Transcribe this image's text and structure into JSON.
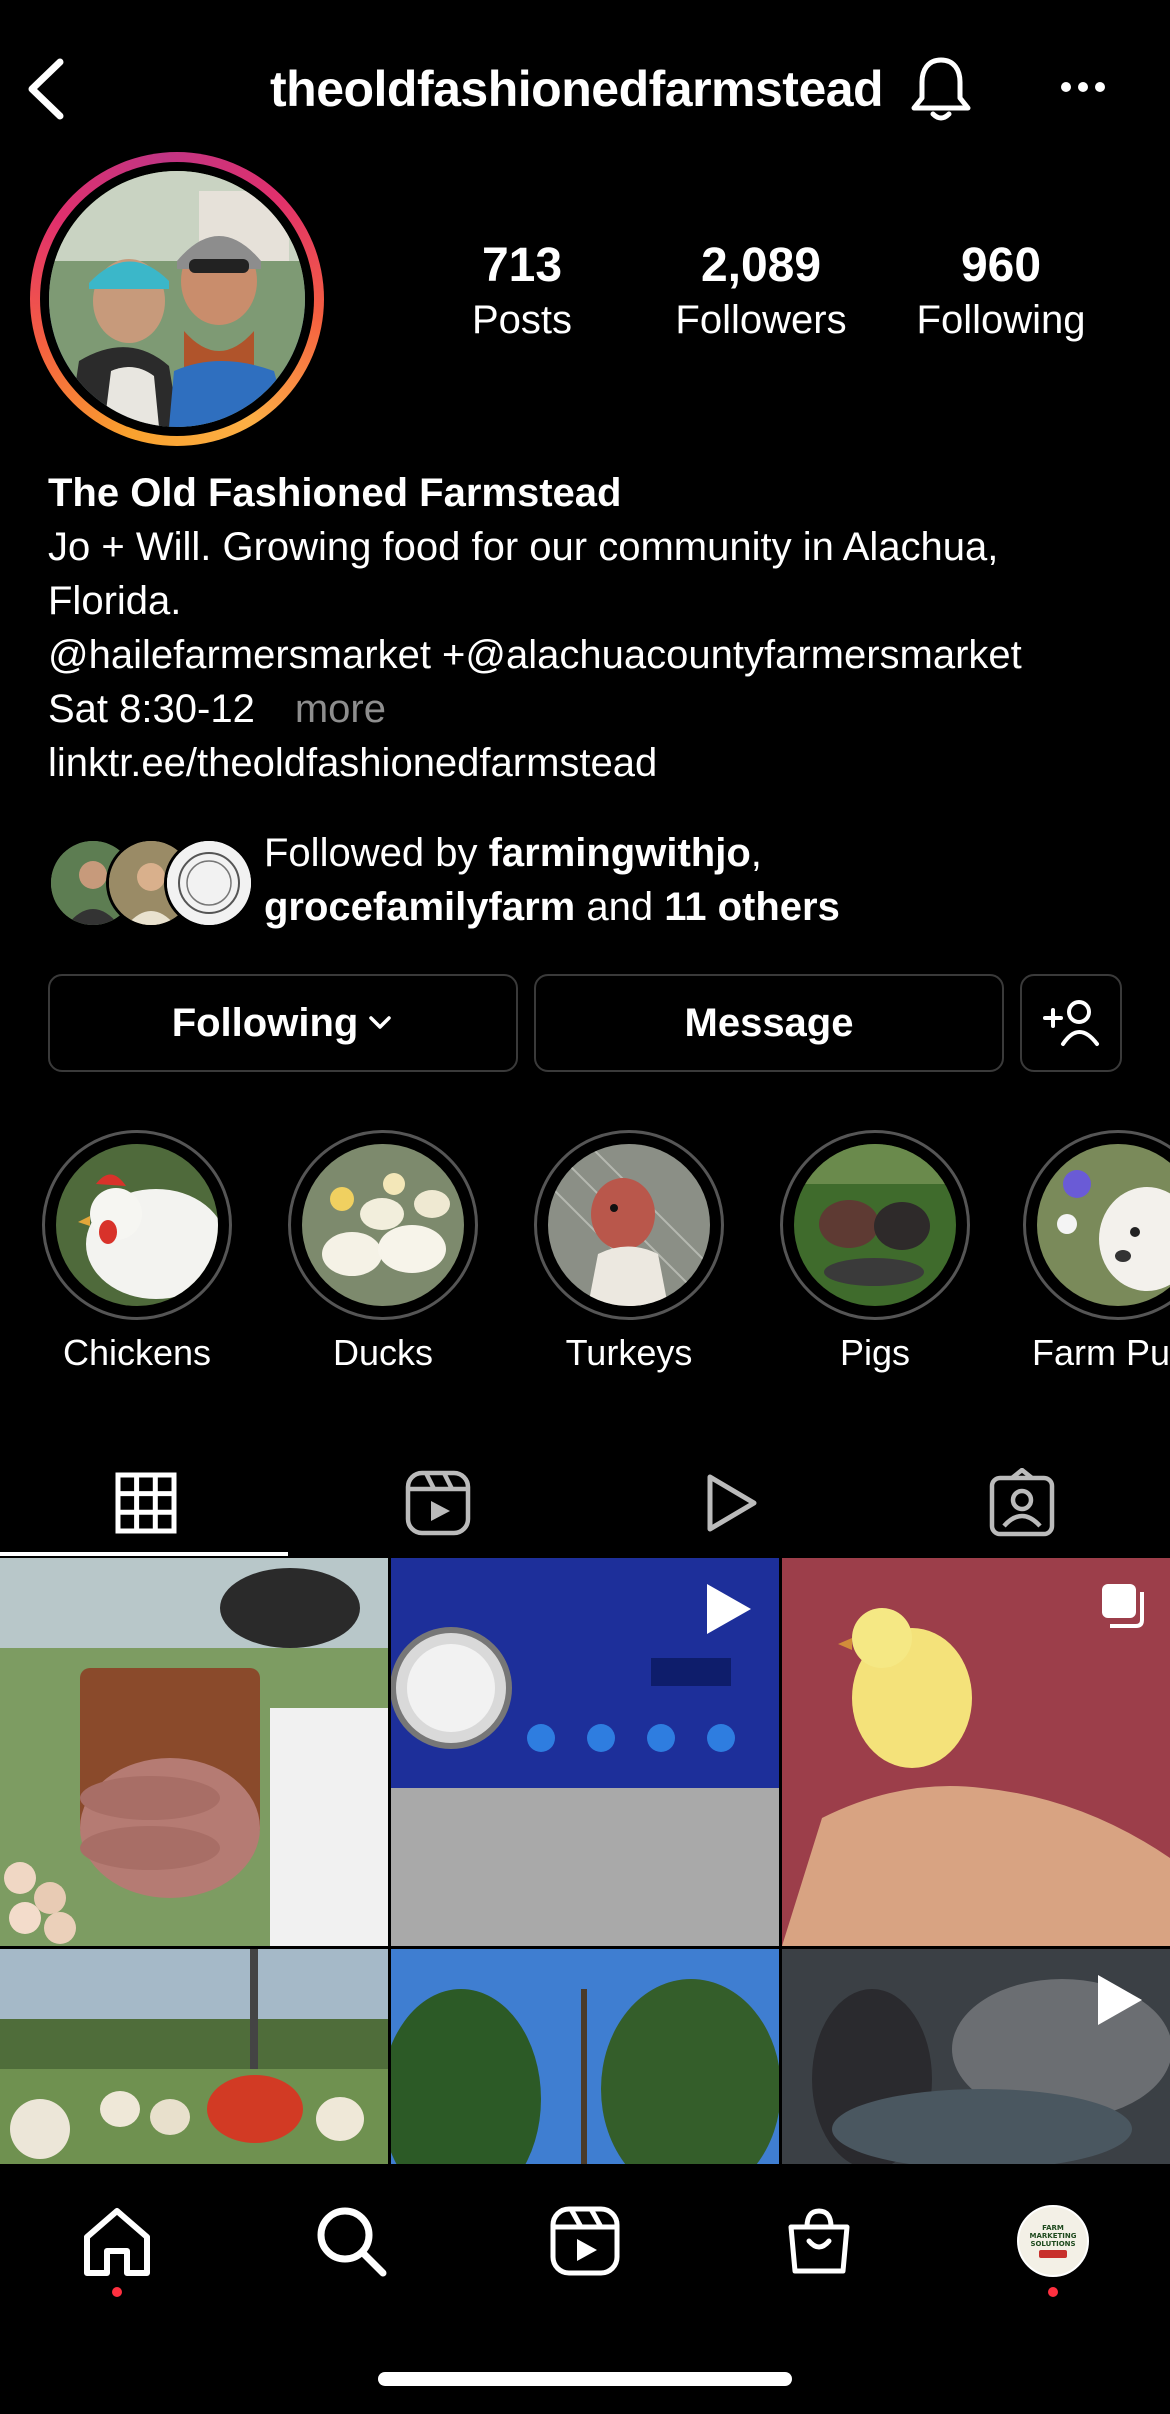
{
  "header": {
    "username": "theoldfashionedfarmstead"
  },
  "stats": [
    {
      "value": "713",
      "label": "Posts"
    },
    {
      "value": "2,089",
      "label": "Followers"
    },
    {
      "value": "960",
      "label": "Following"
    }
  ],
  "bio": {
    "name": "The Old Fashioned Farmstead",
    "line1": "Jo + Will. Growing food for our community in Alachua,",
    "line2": "Florida.",
    "line3": "@hailefarmersmarket +@alachuacountyfarmersmarket",
    "line4": "Sat 8:30-12",
    "more": "more",
    "link": "linktr.ee/theoldfashionedfarmstead"
  },
  "followed_by": {
    "prefix": "Followed by ",
    "user1": "farmingwithjo",
    "sep": ",",
    "user2": "grocefamilyfarm",
    "and": " and ",
    "others": "11 others"
  },
  "buttons": {
    "following": "Following",
    "message": "Message"
  },
  "highlights": [
    {
      "label": "Chickens"
    },
    {
      "label": "Ducks"
    },
    {
      "label": "Turkeys"
    },
    {
      "label": "Pigs"
    },
    {
      "label": "Farm Pu"
    }
  ],
  "tabs": [
    "grid-icon",
    "reels-icon",
    "play-icon",
    "tagged-icon"
  ],
  "avatar_badge": {
    "line1": "FARM",
    "line2": "MARKETING",
    "line3": "SOLUTIONS"
  },
  "colors": {
    "background": "#000000",
    "text": "#ffffff",
    "muted": "#8e8e8e",
    "notification": "#ff3040",
    "button_border": "#3a3a3a"
  }
}
